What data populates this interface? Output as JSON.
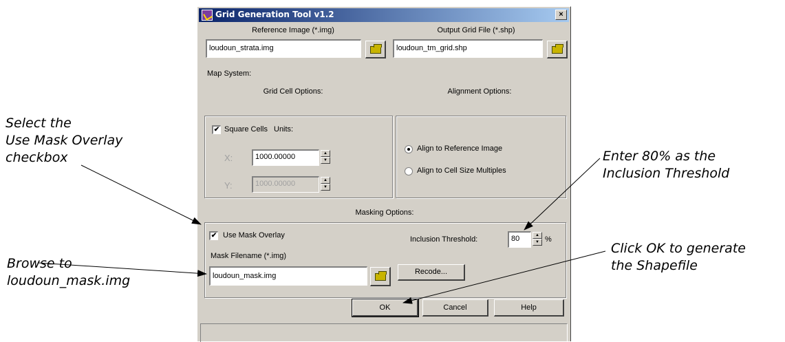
{
  "window": {
    "title": "Grid Generation Tool v1.2",
    "close_glyph": "×"
  },
  "reference": {
    "label": "Reference Image (*.img)",
    "value": "loudoun_strata.img"
  },
  "output": {
    "label": "Output Grid File (*.shp)",
    "value": "loudoun_tm_grid.shp"
  },
  "map_system_label": "Map System:",
  "grid_cell": {
    "label": "Grid Cell Options:",
    "square_cells_label": "Square Cells",
    "square_cells_checked": true,
    "units_label": "Units:",
    "x_label": "X:",
    "x_value": "1000.00000",
    "y_label": "Y:",
    "y_value": "1000.00000"
  },
  "alignment": {
    "label": "Alignment Options:",
    "option1": "Align to Reference Image",
    "option2": "Align to Cell Size Multiples",
    "selected": "option1"
  },
  "masking": {
    "label": "Masking Options:",
    "use_mask_label": "Use Mask Overlay",
    "use_mask_checked": true,
    "threshold_label": "Inclusion Threshold:",
    "threshold_value": "80",
    "percent": "%",
    "mask_filename_label": "Mask Filename (*.img)",
    "mask_value": "loudoun_mask.img",
    "recode_label": "Recode..."
  },
  "buttons": {
    "ok": "OK",
    "cancel": "Cancel",
    "help": "Help"
  },
  "callouts": {
    "select_line1": "Select the",
    "select_line2": "Use Mask Overlay",
    "select_line3": "checkbox",
    "browse_line1": "Browse to",
    "browse_line2": "loudoun_mask.img",
    "enter_line1": "Enter 80% as the",
    "enter_line2": "Inclusion Threshold",
    "click_line1": "Click OK to generate",
    "click_line2": "the Shapefile"
  },
  "icons": {
    "browse": "folder-open-icon",
    "check": "✔"
  },
  "colors": {
    "titlebar_start": "#0a246a",
    "titlebar_end": "#a6caf0",
    "dialog_bg": "#d4d0c8"
  }
}
